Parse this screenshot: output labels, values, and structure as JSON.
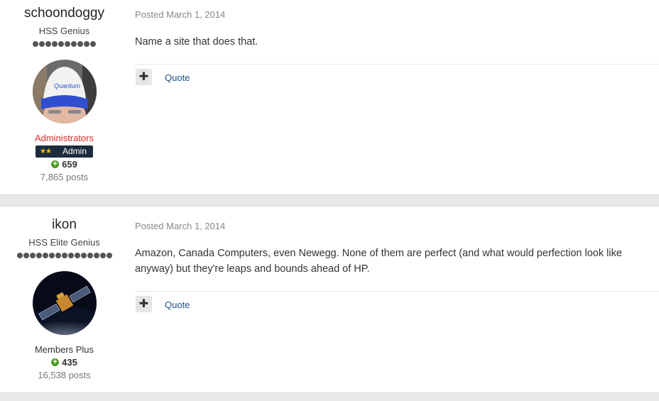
{
  "posts": [
    {
      "username": "schoondoggy",
      "rank_title": "HSS Genius",
      "pip_count": 10,
      "group": "Administrators",
      "badge": {
        "stars": "★★",
        "label": "Admin",
        "bg_color": "#1c2b3e"
      },
      "reputation": "659",
      "post_count": "7,865 posts",
      "posted_label": "Posted",
      "posted_date": "March 1, 2014",
      "content_lines": [
        "Name a site that does that."
      ],
      "quote_label": "Quote",
      "avatar_icon": "avatar-cap-icon"
    },
    {
      "username": "ikon",
      "rank_title": "HSS Elite Genius",
      "pip_count": 15,
      "group": "Members Plus",
      "reputation": "435",
      "post_count": "16,538 posts",
      "posted_label": "Posted",
      "posted_date": "March 1, 2014",
      "content_lines": [
        "Amazon, Canada Computers, even Newegg. None of them are perfect (and what would perfection look like",
        "anyway) but they're leaps and bounds ahead of HP."
      ],
      "quote_label": "Quote",
      "avatar_icon": "avatar-satellite-icon"
    }
  ],
  "colors": {
    "admin_group": "#e02b2b",
    "reputation_positive": "#4e9a2a",
    "link": "#1d5185"
  }
}
